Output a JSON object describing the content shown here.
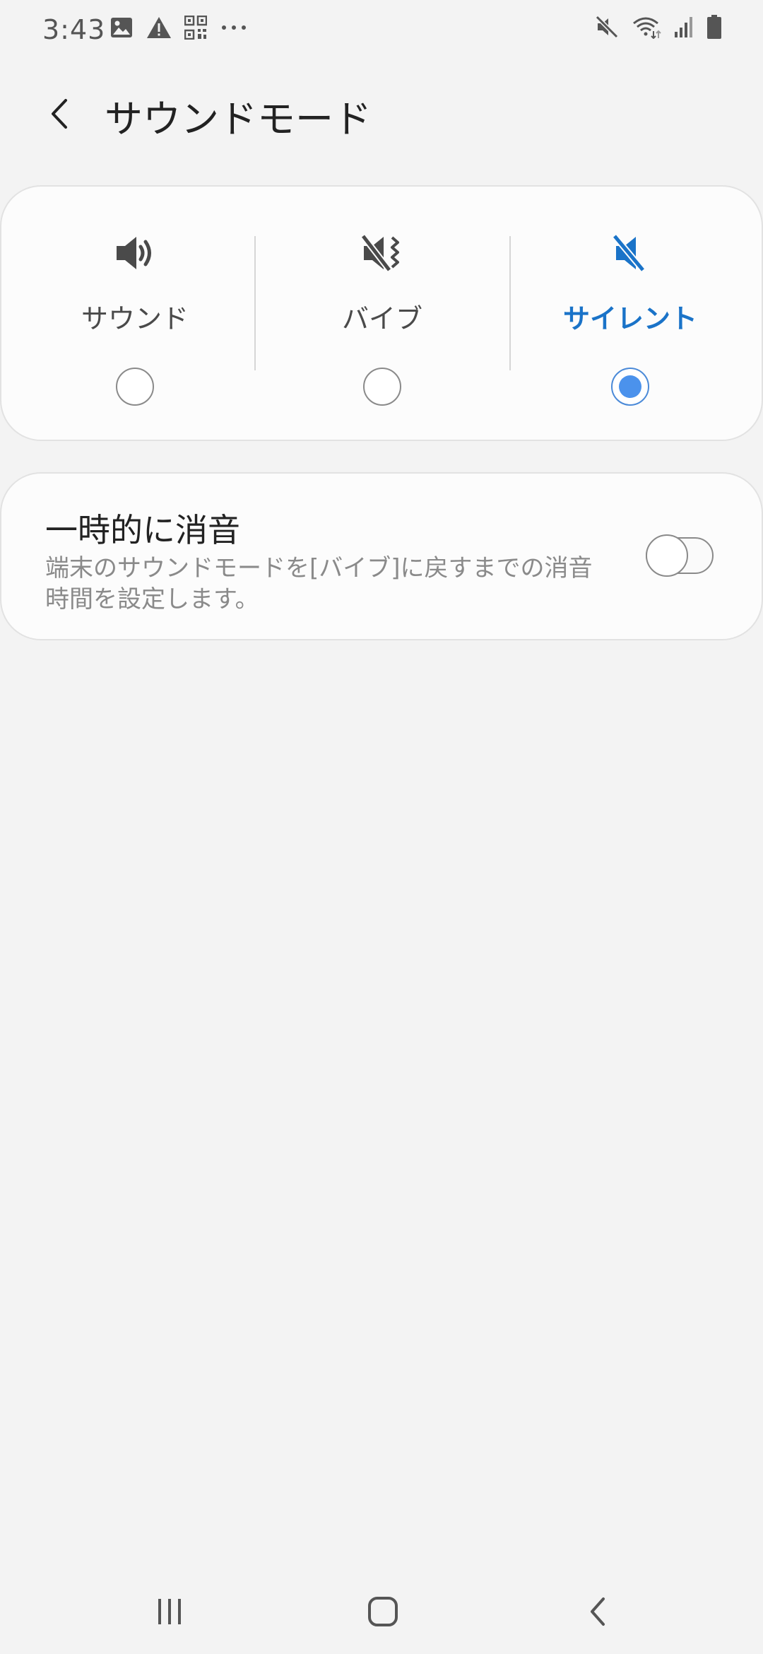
{
  "status_bar": {
    "time": "3:43",
    "left_icons": [
      "gallery-icon",
      "warning-icon",
      "qr-code-icon",
      "more-notifications-icon"
    ],
    "right_icons": [
      "mute-icon",
      "wifi-icon",
      "signal-icon",
      "battery-icon"
    ]
  },
  "app_bar": {
    "title": "サウンドモード"
  },
  "sound_mode": {
    "options": [
      {
        "label": "サウンド",
        "icon": "speaker-icon",
        "selected": false
      },
      {
        "label": "バイブ",
        "icon": "vibrate-icon",
        "selected": false
      },
      {
        "label": "サイレント",
        "icon": "mute-icon",
        "selected": true
      }
    ],
    "accent_color": "#1a73c8"
  },
  "temporary_mute": {
    "title": "一時的に消音",
    "description": "端末のサウンドモードを[バイブ]に戻すまでの消音時間を設定します。",
    "enabled": false
  },
  "nav_bar": {
    "buttons": [
      "recent-apps-icon",
      "home-icon",
      "back-icon"
    ]
  }
}
